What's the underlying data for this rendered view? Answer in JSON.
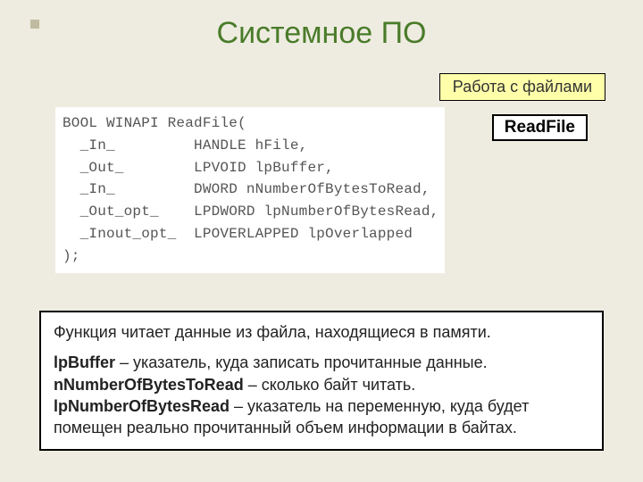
{
  "title": "Системное ПО",
  "subtitle": "Работа с файлами",
  "func_name": "ReadFile",
  "code": "BOOL WINAPI ReadFile(\n  _In_         HANDLE hFile,\n  _Out_        LPVOID lpBuffer,\n  _In_         DWORD nNumberOfBytesToRead,\n  _Out_opt_    LPDWORD lpNumberOfBytesRead,\n  _Inout_opt_  LPOVERLAPPED lpOverlapped\n);",
  "desc": {
    "line1": "Функция читает данные из файла, находящиеся в памяти.",
    "p1_b": "lpBuffer",
    "p1_t": " – указатель, куда записать прочитанные данные.",
    "p2_b": "nNumberOfBytesToRead",
    "p2_t": " – сколько байт читать.",
    "p3_b": "lpNumberOfBytesRead",
    "p3_t": " – указатель на переменную, куда будет помещен реально прочитанный объем информации в байтах."
  }
}
